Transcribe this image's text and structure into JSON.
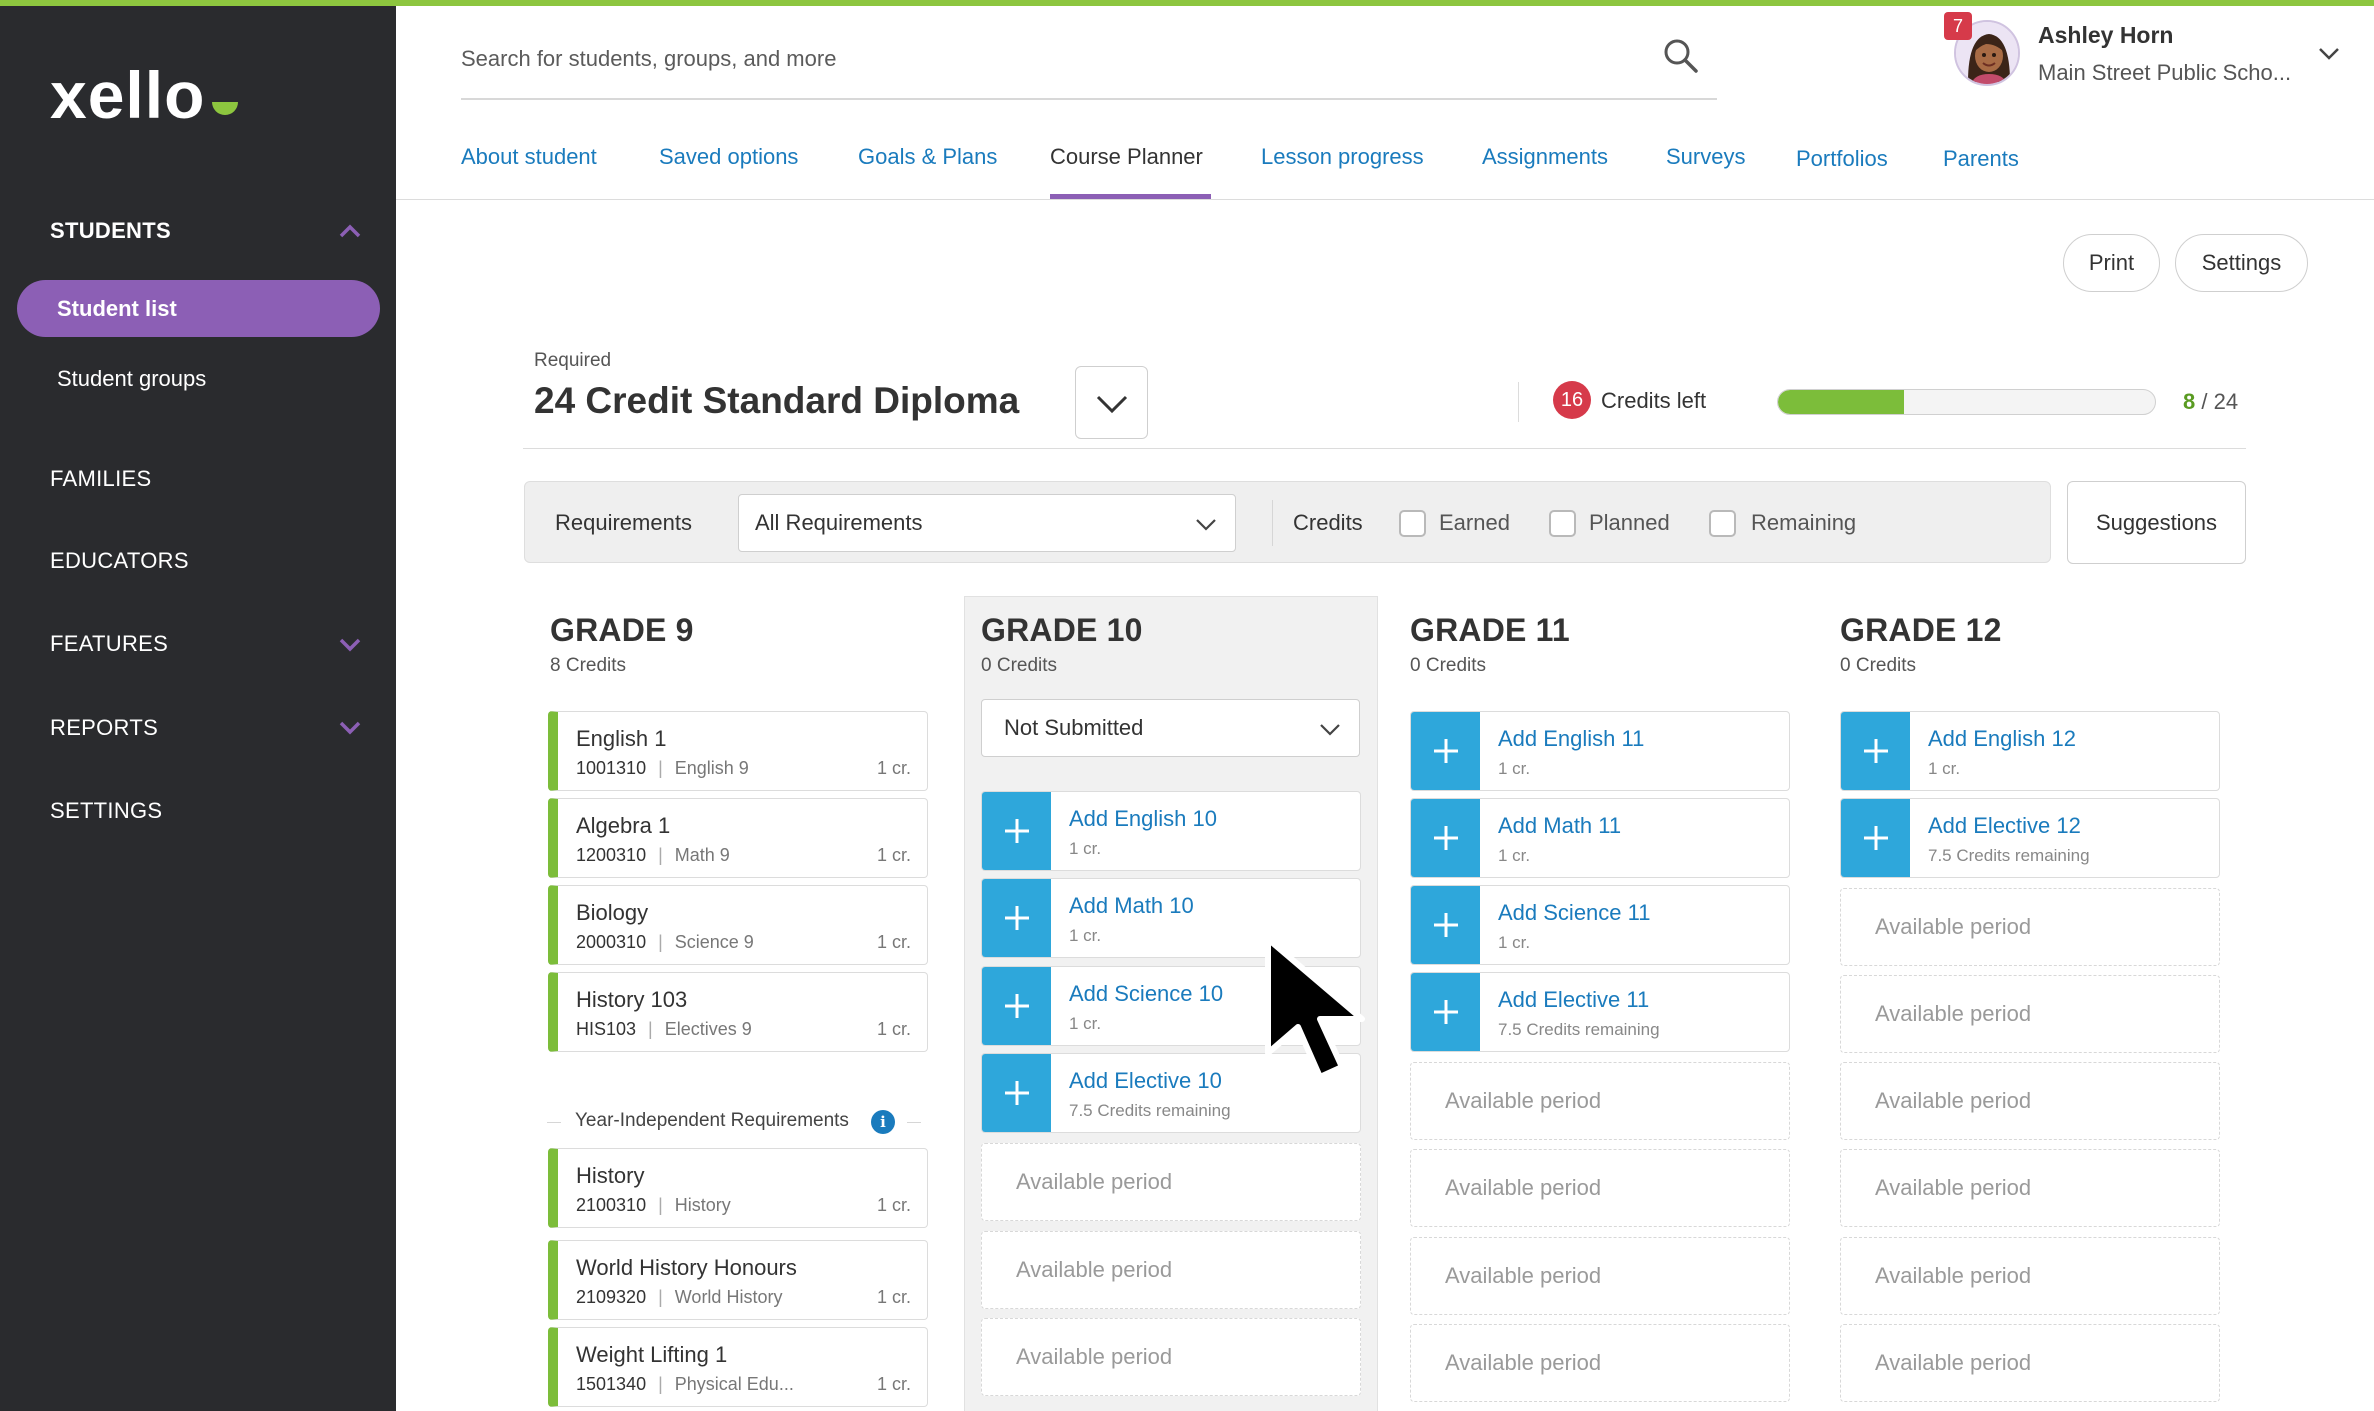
{
  "colors": {
    "accent_purple": "#8c5fb5",
    "link_blue": "#1a7bbd",
    "add_blue": "#2ea7db",
    "green": "#7cbd3a",
    "badge_red": "#d63a4a",
    "sidebar_bg": "#2a2b2e"
  },
  "brand": {
    "logo": "xello"
  },
  "sidebar": {
    "students": "STUDENTS",
    "student_list": "Student list",
    "student_groups": "Student groups",
    "families": "FAMILIES",
    "educators": "EDUCATORS",
    "features": "FEATURES",
    "reports": "REPORTS",
    "settings": "SETTINGS"
  },
  "search": {
    "placeholder": "Search for students, groups, and more",
    "icon": "search-icon"
  },
  "user": {
    "name": "Ashley Horn",
    "school": "Main Street Public Scho...",
    "notifications": "7"
  },
  "tabs": [
    {
      "label": "About student"
    },
    {
      "label": "Saved options"
    },
    {
      "label": "Goals & Plans"
    },
    {
      "label": "Course Planner",
      "active": true
    },
    {
      "label": "Lesson progress"
    },
    {
      "label": "Assignments"
    },
    {
      "label": "Surveys"
    },
    {
      "label": "Portfolios"
    },
    {
      "label": "Parents"
    }
  ],
  "actions": {
    "print": "Print",
    "settings": "Settings"
  },
  "diploma": {
    "required_label": "Required",
    "title": "24 Credit Standard Diploma",
    "credits_left_count": "16",
    "credits_left_label": "Credits left",
    "earned": "8",
    "total": "/ 24",
    "progress_fraction": 0.333
  },
  "filters": {
    "requirements_label": "Requirements",
    "requirements_value": "All Requirements",
    "credits_label": "Credits",
    "earned": "Earned",
    "planned": "Planned",
    "remaining": "Remaining",
    "suggestions": "Suggestions"
  },
  "grades": {
    "g9": {
      "title": "GRADE 9",
      "credits": "8 Credits",
      "courses": [
        {
          "name": "English 1",
          "code": "1001310",
          "category": "English 9",
          "cr": "1 cr."
        },
        {
          "name": "Algebra 1",
          "code": "1200310",
          "category": "Math 9",
          "cr": "1 cr."
        },
        {
          "name": "Biology",
          "code": "2000310",
          "category": "Science 9",
          "cr": "1 cr."
        },
        {
          "name": "History 103",
          "code": "HIS103",
          "category": "Electives 9",
          "cr": "1 cr."
        }
      ],
      "year_independent_label": "Year-Independent Requirements",
      "yi_courses": [
        {
          "name": "History",
          "code": "2100310",
          "category": "History",
          "cr": "1 cr."
        },
        {
          "name": "World History Honours",
          "code": "2109320",
          "category": "World History",
          "cr": "1 cr."
        },
        {
          "name": "Weight Lifting 1",
          "code": "1501340",
          "category": "Physical Edu...",
          "cr": "1 cr."
        }
      ]
    },
    "g10": {
      "title": "GRADE 10",
      "credits": "0 Credits",
      "status": "Not Submitted",
      "adds": [
        {
          "title": "Add English 10",
          "sub": "1 cr."
        },
        {
          "title": "Add Math 10",
          "sub": "1 cr."
        },
        {
          "title": "Add Science 10",
          "sub": "1 cr."
        },
        {
          "title": "Add Elective 10",
          "sub": "7.5 Credits remaining"
        }
      ],
      "available": [
        "Available period",
        "Available period",
        "Available period"
      ]
    },
    "g11": {
      "title": "GRADE 11",
      "credits": "0 Credits",
      "adds": [
        {
          "title": "Add English 11",
          "sub": "1 cr."
        },
        {
          "title": "Add Math 11",
          "sub": "1 cr."
        },
        {
          "title": "Add Science 11",
          "sub": "1 cr."
        },
        {
          "title": "Add Elective 11",
          "sub": "7.5 Credits remaining"
        }
      ],
      "available": [
        "Available period",
        "Available period",
        "Available period",
        "Available period"
      ]
    },
    "g12": {
      "title": "GRADE 12",
      "credits": "0 Credits",
      "adds": [
        {
          "title": "Add English 12",
          "sub": "1 cr."
        },
        {
          "title": "Add Elective 12",
          "sub": "7.5 Credits remaining"
        }
      ],
      "available": [
        "Available period",
        "Available period",
        "Available period",
        "Available period",
        "Available period",
        "Available period"
      ]
    }
  }
}
